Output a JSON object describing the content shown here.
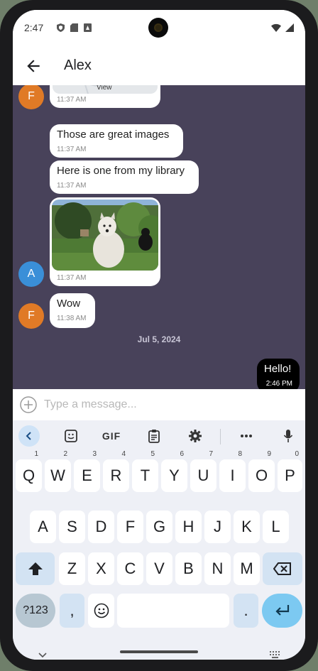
{
  "status_bar": {
    "time": "2:47"
  },
  "app_bar": {
    "title": "Alex"
  },
  "messages": [
    {
      "avatar": "F",
      "avatar_color": "#e07a26",
      "text": "",
      "time": "11:37 AM",
      "map_label": "View"
    },
    {
      "text": "Those are great images",
      "time": "11:37 AM"
    },
    {
      "text": "Here is one from my library",
      "time": "11:37 AM"
    },
    {
      "avatar": "A",
      "avatar_color": "#3a8fd8",
      "image": "dog-photo",
      "time": "11:37 AM"
    },
    {
      "avatar": "F",
      "avatar_color": "#e07a26",
      "text": "Wow",
      "time": "11:38 AM"
    }
  ],
  "date_separator": "Jul 5, 2024",
  "outgoing": {
    "text": "Hello!",
    "time": "2:46 PM"
  },
  "composer": {
    "placeholder": "Type a message..."
  },
  "keyboard": {
    "toolbar": [
      "chevron-left-icon",
      "sticker-icon",
      "GIF",
      "clipboard-icon",
      "gear-icon",
      "more-icon",
      "mic-icon"
    ],
    "row1": [
      {
        "k": "Q",
        "h": "1"
      },
      {
        "k": "W",
        "h": "2"
      },
      {
        "k": "E",
        "h": "3"
      },
      {
        "k": "R",
        "h": "4"
      },
      {
        "k": "T",
        "h": "5"
      },
      {
        "k": "Y",
        "h": "6"
      },
      {
        "k": "U",
        "h": "7"
      },
      {
        "k": "I",
        "h": "8"
      },
      {
        "k": "O",
        "h": "9"
      },
      {
        "k": "P",
        "h": "0"
      }
    ],
    "row2": [
      "A",
      "S",
      "D",
      "F",
      "G",
      "H",
      "J",
      "K",
      "L"
    ],
    "row3": [
      "Z",
      "X",
      "C",
      "V",
      "B",
      "N",
      "M"
    ],
    "symbols_key": "?123",
    "comma_key": ",",
    "period_key": "."
  },
  "colors": {
    "chat_bg": "#48425a",
    "accent": "#7cc9f1"
  }
}
